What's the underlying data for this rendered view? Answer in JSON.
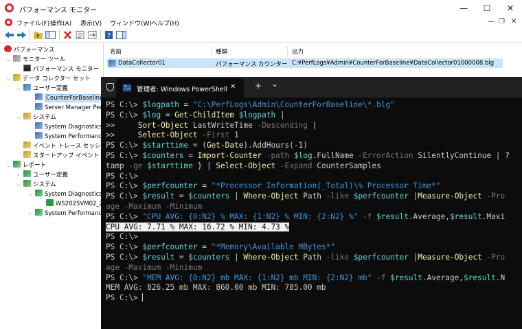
{
  "window": {
    "title": "パフォーマンス モニター",
    "controls": {
      "minimize": "—",
      "maximize": "☐",
      "close": "✕"
    }
  },
  "menubar": {
    "items": [
      "ファイル(F)",
      "操作(A)",
      "表示(V)",
      "ウィンドウ(W)",
      "ヘルプ(H)"
    ],
    "mdi_controls": {
      "minimize": "—",
      "restore": "❐",
      "close": "✕"
    }
  },
  "tree": {
    "root": "パフォーマンス",
    "monitor_tools": "モニター ツール",
    "perf_monitor": "パフォーマンス モニター",
    "data_collector_sets": "データ コレクター セット",
    "user_defined": "ユーザー定義",
    "counter_for_baseline": "CounterForBaseline",
    "server_manager": "Server Manager Per",
    "system": "システム",
    "system_diagnostics": "System Diagnostics",
    "system_performance": "System Performanc",
    "event_trace": "イベント トレース セッション",
    "startup_event": "スタートアップ イベント ト",
    "reports": "レポート",
    "reports_user_defined": "ユーザー定義",
    "reports_system": "システム",
    "reports_system_diagnostics": "System Diagnostics",
    "report_item": "WS2025VM02_2",
    "reports_system_performance": "System Performanc"
  },
  "list": {
    "headers": [
      "名前",
      "種類",
      "出力"
    ],
    "rows": [
      {
        "name": "DataCollector01",
        "type": "パフォーマンス カウンター",
        "output": "C:¥PerfLogs¥Admin¥CounterForBaseline¥DataCollector01000008.blg"
      }
    ]
  },
  "powershell": {
    "tab_title": "管理者: Windows PowerShell",
    "tab_close": "✕",
    "new_tab": "+",
    "dropdown": "⌄",
    "prompt": "PS C:\\> ",
    "continuation": ">> ",
    "l1_var": "$logpath",
    "l1_eq": " = ",
    "l1_str": "\"C:\\PerfLogs\\Admin\\CounterForBaseline\\*.blg\"",
    "l2_var": "$log",
    "l2_eq": " = ",
    "l2_cmd": "Get-ChildItem",
    "l2_sp": " ",
    "l2_arg": "$logpath",
    "l2_pipe": " |",
    "l3_pad": "    ",
    "l3_cmd": "Sort-Object",
    "l3_a": " LastWriteTime ",
    "l3_opt": "-Descending",
    "l3_pipe": " |",
    "l4_pad": "    ",
    "l4_cmd": "Select-Object",
    "l4_sp": " ",
    "l4_opt": "-First",
    "l4_val": " 1",
    "l5_var": "$starttime",
    "l5_eq": " = (",
    "l5_cmd": "Get-Date",
    "l5_rest": ").AddHours(-1)",
    "l6_var": "$counters",
    "l6_eq": " = ",
    "l6_cmd": "Import-Counter",
    "l6_sp": " ",
    "l6_opt1": "-path",
    "l6_sp2": " ",
    "l6_v2": "$log",
    "l6_prop": ".FullName ",
    "l6_opt2": "-ErrorAction",
    "l6_val": " SilentlyContinue | ",
    "l6_tail": "?",
    "l7_head": "tamp ",
    "l7_opt": "-ge",
    "l7_sp": " ",
    "l7_var": "$starttime",
    "l7_mid": " } | ",
    "l7_cmd": "Select-Object",
    "l7_sp2": " ",
    "l7_opt2": "-Expand",
    "l7_val": " CounterSamples",
    "l9_var": "$perfcounter",
    "l9_eq": " = ",
    "l9_str": "\"*Processor Information(_Total)\\% Processor Time*\"",
    "l10_var": "$result",
    "l10_eq": " = ",
    "l10_v2": "$counters",
    "l10_pipe": " | ",
    "l10_cmd": "Where-Object",
    "l10_a": " Path ",
    "l10_opt": "-like",
    "l10_sp": " ",
    "l10_v3": "$perfcounter",
    "l10_pipe2": " |",
    "l10_cmd2": "Measure-Object",
    "l10_sp2": " ",
    "l10_opt2": "-Pro",
    "l11_opt1": "age",
    "l11_sp": " ",
    "l11_opt2": "-Maximum",
    "l11_sp2": " ",
    "l11_opt3": "-Minimum",
    "l12_str": "\"CPU AVG: {0:N2} % MAX: {1:N2} % MIN: {2:N2} %\"",
    "l12_sp": " ",
    "l12_opt": "-f",
    "l12_sp2": " ",
    "l12_v1": "$result",
    "l12_p1": ".Average,",
    "l12_v2": "$result",
    "l12_p2": ".Maxi",
    "cpu_output": "CPU AVG: 7.71 % MAX: 16.72 % MIN: 4.73 %",
    "l15_var": "$perfcounter",
    "l15_eq": " = ",
    "l15_str": "\"*Memory\\Available MBytes*\"",
    "l16_var": "$result",
    "l16_eq": " = ",
    "l16_v2": "$counters",
    "l16_pipe": " | ",
    "l16_cmd": "Where-Object",
    "l16_a": " Path ",
    "l16_opt": "-like",
    "l16_sp": " ",
    "l16_v3": "$perfcounter",
    "l16_pipe2": " |",
    "l16_cmd2": "Measure-Object",
    "l16_sp2": " ",
    "l16_opt2": "-Pro",
    "l17_opt1": "age",
    "l17_sp": " ",
    "l17_opt2": "-Maximum",
    "l17_sp2": " ",
    "l17_opt3": "-Minimum",
    "l18_str": "\"MEM AVG: {0:N2} mb MAX: {1:N2} mb MIN: {2:N2} mb\"",
    "l18_sp": " ",
    "l18_opt": "-f",
    "l18_sp2": " ",
    "l18_v1": "$result",
    "l18_p1": ".Average,",
    "l18_v2": "$result",
    "l18_p2": ".N",
    "mem_output": "MEM AVG: 826.25 mb MAX: 860.00 mb MIN: 785.00 mb"
  },
  "colors": {
    "terminal_bg": "#0c0c0c",
    "variable": "#61d6d6",
    "cmdlet": "#f9f1a5",
    "string": "#3a96dd",
    "operator": "#767676",
    "selection": "#cce4f7"
  }
}
